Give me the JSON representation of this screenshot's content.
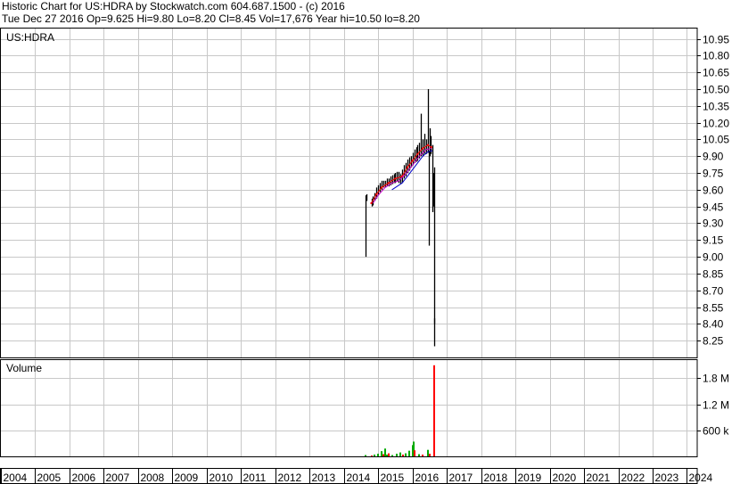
{
  "header": {
    "line1": "Historic Chart for US:HDRA by Stockwatch.com 604.687.1500 - (c) 2016",
    "line2": "Tue Dec 27 2016   Op=9.625   Hi=9.80   Lo=8.20   Cl=8.45   Vol=17,676   Year hi=10.50   lo=8.20"
  },
  "colors": {
    "grid": "#c8c8c8",
    "frame": "#000000",
    "price_bar": "#000000",
    "ma_red": "#ff0000",
    "ma_magenta": "#cc00cc",
    "ma_blue": "#0000cc",
    "vol_up": "#00aa00",
    "vol_down": "#ff0000"
  },
  "chart_data": [
    {
      "type": "line",
      "panel": "price",
      "title": "US:HDRA",
      "ylim": [
        8.1,
        11.05
      ],
      "yticks": [
        "10.95",
        "10.80",
        "10.65",
        "10.50",
        "10.35",
        "10.20",
        "10.05",
        "9.90",
        "9.75",
        "9.60",
        "9.45",
        "9.30",
        "9.15",
        "9.00",
        "8.85",
        "8.70",
        "8.55",
        "8.40",
        "8.25"
      ],
      "xlim": [
        2004,
        2024.3
      ],
      "xticks": [
        "2004",
        "2005",
        "2006",
        "2007",
        "2008",
        "2009",
        "2010",
        "2011",
        "2012",
        "2013",
        "2014",
        "2015",
        "2016",
        "2017",
        "2018",
        "2019",
        "2020",
        "2021",
        "2022",
        "2023",
        "2024"
      ],
      "bars": [
        {
          "x": 2014.62,
          "lo": 9.0,
          "hi": 9.55
        },
        {
          "x": 2014.66,
          "lo": 9.5,
          "hi": 9.56
        },
        {
          "x": 2014.8,
          "lo": 9.45,
          "hi": 9.52
        },
        {
          "x": 2014.85,
          "lo": 9.46,
          "hi": 9.54
        },
        {
          "x": 2014.9,
          "lo": 9.5,
          "hi": 9.57
        },
        {
          "x": 2014.95,
          "lo": 9.52,
          "hi": 9.62
        },
        {
          "x": 2015.0,
          "lo": 9.55,
          "hi": 9.64
        },
        {
          "x": 2015.05,
          "lo": 9.58,
          "hi": 9.66
        },
        {
          "x": 2015.1,
          "lo": 9.6,
          "hi": 9.68
        },
        {
          "x": 2015.15,
          "lo": 9.62,
          "hi": 9.68
        },
        {
          "x": 2015.2,
          "lo": 9.62,
          "hi": 9.68
        },
        {
          "x": 2015.25,
          "lo": 9.63,
          "hi": 9.7
        },
        {
          "x": 2015.3,
          "lo": 9.63,
          "hi": 9.7
        },
        {
          "x": 2015.35,
          "lo": 9.64,
          "hi": 9.72
        },
        {
          "x": 2015.4,
          "lo": 9.65,
          "hi": 9.73
        },
        {
          "x": 2015.45,
          "lo": 9.66,
          "hi": 9.74
        },
        {
          "x": 2015.5,
          "lo": 9.66,
          "hi": 9.75
        },
        {
          "x": 2015.55,
          "lo": 9.67,
          "hi": 9.76
        },
        {
          "x": 2015.6,
          "lo": 9.66,
          "hi": 9.76
        },
        {
          "x": 2015.65,
          "lo": 9.65,
          "hi": 9.74
        },
        {
          "x": 2015.7,
          "lo": 9.66,
          "hi": 9.78
        },
        {
          "x": 2015.75,
          "lo": 9.7,
          "hi": 9.82
        },
        {
          "x": 2015.8,
          "lo": 9.72,
          "hi": 9.84
        },
        {
          "x": 2015.85,
          "lo": 9.75,
          "hi": 9.87
        },
        {
          "x": 2015.9,
          "lo": 9.77,
          "hi": 9.89
        },
        {
          "x": 2015.95,
          "lo": 9.8,
          "hi": 9.9
        },
        {
          "x": 2016.0,
          "lo": 9.82,
          "hi": 9.93
        },
        {
          "x": 2016.05,
          "lo": 9.84,
          "hi": 9.96
        },
        {
          "x": 2016.1,
          "lo": 9.85,
          "hi": 9.98
        },
        {
          "x": 2016.15,
          "lo": 9.86,
          "hi": 10.0
        },
        {
          "x": 2016.2,
          "lo": 9.88,
          "hi": 10.02
        },
        {
          "x": 2016.25,
          "lo": 9.9,
          "hi": 10.28
        },
        {
          "x": 2016.3,
          "lo": 9.9,
          "hi": 10.05
        },
        {
          "x": 2016.35,
          "lo": 9.92,
          "hi": 10.1
        },
        {
          "x": 2016.4,
          "lo": 9.92,
          "hi": 10.05
        },
        {
          "x": 2016.45,
          "lo": 9.93,
          "hi": 10.5
        },
        {
          "x": 2016.48,
          "lo": 9.1,
          "hi": 9.95
        },
        {
          "x": 2016.5,
          "lo": 9.9,
          "hi": 10.15
        },
        {
          "x": 2016.53,
          "lo": 9.92,
          "hi": 10.08
        },
        {
          "x": 2016.57,
          "lo": 9.4,
          "hi": 10.0
        },
        {
          "x": 2016.6,
          "lo": 9.45,
          "hi": 9.75
        },
        {
          "x": 2016.62,
          "lo": 8.2,
          "hi": 9.8
        },
        {
          "x": 2016.64,
          "lo": 8.4,
          "hi": 8.45
        }
      ],
      "series": [
        {
          "color": "#ff0000",
          "points": [
            [
              2014.8,
              9.48
            ],
            [
              2014.95,
              9.56
            ],
            [
              2015.1,
              9.62
            ],
            [
              2015.3,
              9.66
            ],
            [
              2015.5,
              9.7
            ],
            [
              2015.7,
              9.72
            ],
            [
              2015.85,
              9.8
            ],
            [
              2016.0,
              9.86
            ],
            [
              2016.15,
              9.92
            ],
            [
              2016.3,
              9.97
            ],
            [
              2016.45,
              10.0
            ],
            [
              2016.55,
              9.98
            ]
          ]
        },
        {
          "color": "#cc00cc",
          "points": [
            [
              2014.85,
              9.48
            ],
            [
              2015.0,
              9.55
            ],
            [
              2015.2,
              9.62
            ],
            [
              2015.4,
              9.66
            ],
            [
              2015.6,
              9.68
            ],
            [
              2015.8,
              9.74
            ],
            [
              2016.0,
              9.82
            ],
            [
              2016.2,
              9.9
            ],
            [
              2016.4,
              9.96
            ],
            [
              2016.55,
              9.97
            ]
          ]
        },
        {
          "color": "#0000cc",
          "points": [
            [
              2015.4,
              9.6
            ],
            [
              2015.55,
              9.63
            ],
            [
              2015.7,
              9.66
            ],
            [
              2015.85,
              9.72
            ],
            [
              2016.0,
              9.78
            ],
            [
              2016.15,
              9.84
            ],
            [
              2016.3,
              9.9
            ],
            [
              2016.45,
              9.94
            ],
            [
              2016.58,
              9.95
            ]
          ]
        }
      ]
    },
    {
      "type": "bar",
      "panel": "volume",
      "title": "Volume",
      "ylim": [
        0,
        2240000
      ],
      "yticks": [
        {
          "v": 1800000,
          "label": "1.8 M"
        },
        {
          "v": 1200000,
          "label": "1.2 M"
        },
        {
          "v": 600000,
          "label": "600 k"
        }
      ],
      "bars": [
        {
          "x": 2014.62,
          "v": 30000,
          "c": "up"
        },
        {
          "x": 2014.8,
          "v": 20000,
          "c": "down"
        },
        {
          "x": 2014.9,
          "v": 40000,
          "c": "up"
        },
        {
          "x": 2015.0,
          "v": 60000,
          "c": "up"
        },
        {
          "x": 2015.1,
          "v": 120000,
          "c": "up"
        },
        {
          "x": 2015.15,
          "v": 50000,
          "c": "down"
        },
        {
          "x": 2015.2,
          "v": 180000,
          "c": "up"
        },
        {
          "x": 2015.25,
          "v": 40000,
          "c": "up"
        },
        {
          "x": 2015.3,
          "v": 70000,
          "c": "down"
        },
        {
          "x": 2015.4,
          "v": 30000,
          "c": "up"
        },
        {
          "x": 2015.55,
          "v": 60000,
          "c": "up"
        },
        {
          "x": 2015.65,
          "v": 90000,
          "c": "up"
        },
        {
          "x": 2015.72,
          "v": 40000,
          "c": "down"
        },
        {
          "x": 2015.8,
          "v": 70000,
          "c": "up"
        },
        {
          "x": 2015.9,
          "v": 130000,
          "c": "up"
        },
        {
          "x": 2016.0,
          "v": 260000,
          "c": "up"
        },
        {
          "x": 2016.03,
          "v": 340000,
          "c": "up"
        },
        {
          "x": 2016.06,
          "v": 140000,
          "c": "down"
        },
        {
          "x": 2016.2,
          "v": 50000,
          "c": "up"
        },
        {
          "x": 2016.3,
          "v": 40000,
          "c": "down"
        },
        {
          "x": 2016.45,
          "v": 150000,
          "c": "up"
        },
        {
          "x": 2016.5,
          "v": 60000,
          "c": "down"
        },
        {
          "x": 2016.62,
          "v": 2100000,
          "c": "down"
        },
        {
          "x": 2016.64,
          "v": 17676,
          "c": "down"
        }
      ]
    }
  ]
}
